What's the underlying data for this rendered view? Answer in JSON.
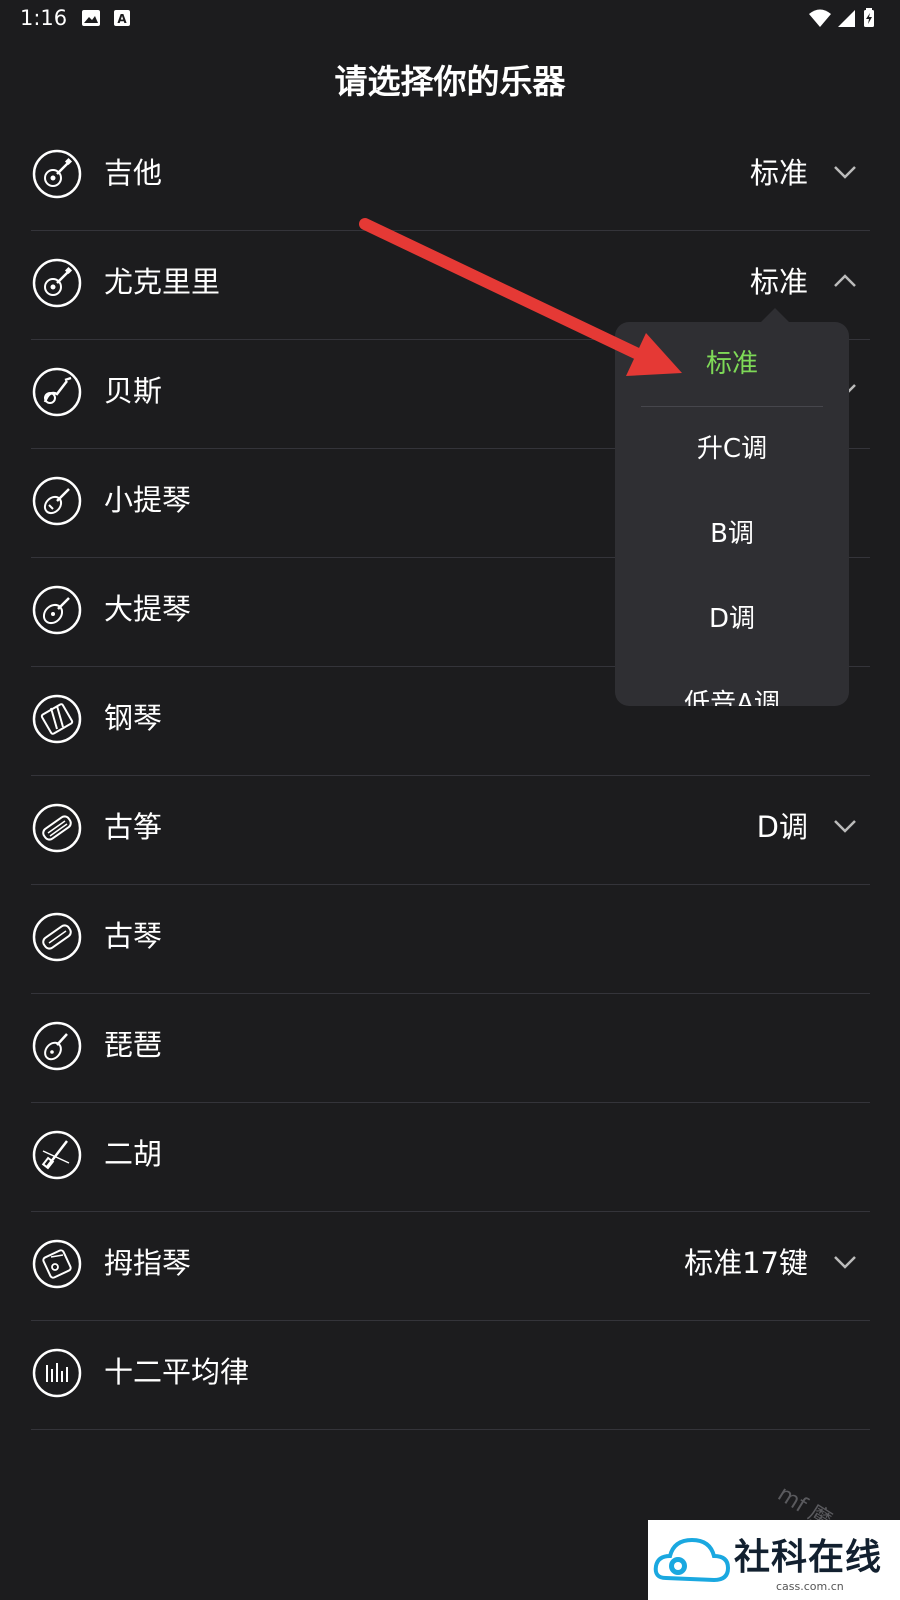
{
  "status_bar": {
    "time": "1:16",
    "left_icons": [
      "image-icon",
      "a-box-icon"
    ],
    "right_icons": [
      "wifi-icon",
      "signal-icon",
      "battery-charging-icon"
    ]
  },
  "title": "请选择你的乐器",
  "instruments": [
    {
      "label": "吉他",
      "icon": "guitar-icon",
      "value": "标准",
      "chevron": "down"
    },
    {
      "label": "尤克里里",
      "icon": "ukulele-icon",
      "value": "标准",
      "chevron": "up"
    },
    {
      "label": "贝斯",
      "icon": "bass-icon",
      "value": "",
      "chevron": "down"
    },
    {
      "label": "小提琴",
      "icon": "violin-icon",
      "value": "",
      "chevron": ""
    },
    {
      "label": "大提琴",
      "icon": "cello-icon",
      "value": "",
      "chevron": ""
    },
    {
      "label": "钢琴",
      "icon": "piano-icon",
      "value": "",
      "chevron": ""
    },
    {
      "label": "古筝",
      "icon": "guzheng-icon",
      "value": "D调",
      "chevron": "down"
    },
    {
      "label": "古琴",
      "icon": "guqin-icon",
      "value": "",
      "chevron": ""
    },
    {
      "label": "琵琶",
      "icon": "pipa-icon",
      "value": "",
      "chevron": ""
    },
    {
      "label": "二胡",
      "icon": "erhu-icon",
      "value": "",
      "chevron": ""
    },
    {
      "label": "拇指琴",
      "icon": "kalimba-icon",
      "value": "标准17键",
      "chevron": "down"
    },
    {
      "label": "十二平均律",
      "icon": "equal-temperament-icon",
      "value": "",
      "chevron": ""
    }
  ],
  "dropdown": {
    "options": [
      "标准",
      "升C调",
      "B调",
      "D调",
      "低音A调"
    ],
    "selected": "标准",
    "selected_color": "#7ed957"
  },
  "annotation": {
    "arrow_color": "#e53935"
  },
  "watermark": {
    "text": "社科在线",
    "subtext": "cass.com.cn",
    "faint_text": "mf 魔...",
    "logo_color": "#1aa8e0"
  },
  "colors": {
    "background": "#1c1c1e",
    "divider": "#34343a",
    "dropdown_bg": "#2f2f33"
  }
}
